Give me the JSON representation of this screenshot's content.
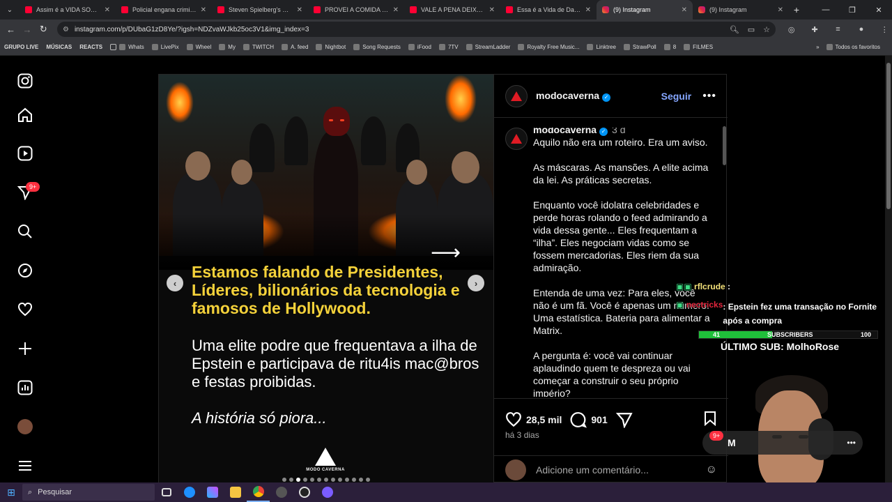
{
  "browser": {
    "tabs": [
      {
        "title": "Assim é a VIDA SOMBRIA",
        "icon": "youtube-icon"
      },
      {
        "title": "Policial engana criminoso",
        "icon": "youtube-icon"
      },
      {
        "title": "Steven Spielberg's DUEL (",
        "icon": "youtube-icon"
      },
      {
        "title": "PROVEI A COMIDA DA M",
        "icon": "youtube-icon"
      },
      {
        "title": "VALE A PENA DEIXAR SU",
        "icon": "youtube-icon"
      },
      {
        "title": "Essa é a Vida de Daniel V",
        "icon": "youtube-icon"
      },
      {
        "title": "(9) Instagram",
        "icon": "instagram-icon",
        "active": true
      },
      {
        "title": "(9) Instagram",
        "icon": "instagram-icon"
      }
    ],
    "url": "instagram.com/p/DUbaG1zD8Ye/?igsh=NDZvaWJkb25oc3V1&img_index=3",
    "bookmarks": [
      "GRUPO LIVE",
      "MÚSICAS",
      "REACTS",
      "Whats",
      "LivePix",
      "Wheel",
      "My",
      "TWITCH",
      "A. feed",
      "Nightbot",
      "Song Requests",
      "iFood",
      "7TV",
      "StreamLadder",
      "Royalty Free Music...",
      "Linktree",
      "StrawPoll",
      "8",
      "FILMES"
    ],
    "bookmarks_all": "Todos os favoritos"
  },
  "sidebar": {
    "notification_badge": "9+"
  },
  "post": {
    "slide": {
      "headline": "Estamos falando de Presidentes, Líderes, bilionários da tecnologia e famosos de Hollywood.",
      "body": "Uma elite podre que frequentava a ilha de Epstein e participava de ritu4is mac@bros e festas proibidas.",
      "tagline": "A história só piora...",
      "brand": "MODO CAVERNA"
    },
    "dots_total": 13,
    "dots_active": 2,
    "header": {
      "username": "modocaverna",
      "follow_label": "Seguir"
    },
    "caption": {
      "username": "modocaverna",
      "time": "3 d",
      "paragraphs": [
        "Aquilo não era um roteiro. Era um aviso.",
        "As máscaras. As mansões. A elite acima da lei. As práticas secretas.",
        "Enquanto você idolatra celebridades e perde horas rolando o feed admirando a vida dessa gente... Eles frequentam a “ilha”. Eles negociam vidas como se fossem mercadorias. Eles riem da sua admiração.",
        "Entenda de uma vez: Para eles, você não é um fã. Você é apenas um número. Uma estatística. Bateria para alimentar a Matrix.",
        "A pergunta é: você vai continuar aplaudindo quem te despreza ou vai começar a construir o seu próprio império?"
      ]
    },
    "likes": "28,5 mil",
    "comments": "901",
    "posted_ago": "há 3 dias",
    "comment_placeholder": "Adicione um comentário..."
  },
  "stream_overlay": {
    "chat": [
      {
        "user": "rflcrude",
        "text": ""
      },
      {
        "user": "nectricks",
        "text": ": Epstein fez uma transação no Fornite após a compra"
      }
    ],
    "subs_current": "41",
    "subs_label": "SUBSCRIBERS",
    "subs_goal": "100",
    "subs_progress": 0.41,
    "last_sub": "ÚLTIMO SUB: MolhoRose",
    "pill_badge": "9+",
    "pill_letter": "M"
  },
  "taskbar": {
    "search_label": "Pesquisar"
  }
}
